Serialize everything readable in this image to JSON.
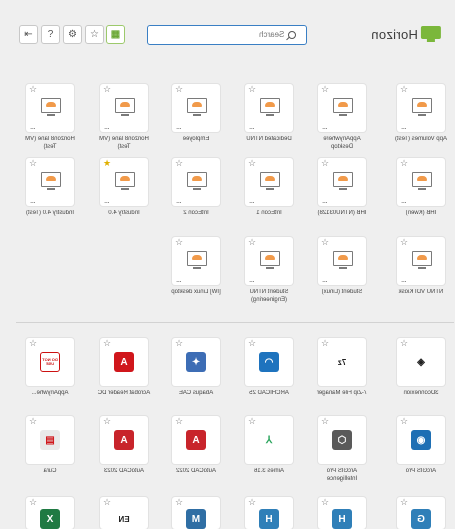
{
  "header": {
    "logo_text": "Horizon",
    "search_placeholder": "Search"
  },
  "toolbar": {
    "buttons": [
      "apps-grid",
      "favorites",
      "settings",
      "help",
      "logout"
    ]
  },
  "desktops": [
    {
      "label": "App Volumes (Test)",
      "fav": false
    },
    {
      "label": "AppAnywhere Desktop",
      "fav": false
    },
    {
      "label": "Dedicated NTNU",
      "fav": false
    },
    {
      "label": "Employee",
      "fav": false
    },
    {
      "label": "Horizon8 lane (VM Test)",
      "fav": false
    },
    {
      "label": "Horizon8 lane (VM Test)",
      "fav": false
    },
    {
      "label": "IHB (Kwen)",
      "fav": false
    },
    {
      "label": "IHB (NTNU03128)",
      "fav": false
    },
    {
      "label": "IntEcon 1",
      "fav": false
    },
    {
      "label": "IntEcon 2",
      "fav": false
    },
    {
      "label": "Industry 4.0",
      "fav": true
    },
    {
      "label": "Industry 4.0 (Test)",
      "fav": false
    },
    {
      "label": "NTNU VDI Kiosk",
      "fav": false
    },
    {
      "label": "Student (Linux)",
      "fav": false
    },
    {
      "label": "Student NTNU (Engineering)",
      "fav": false
    },
    {
      "label": "[IW] Linux desktop",
      "fav": false
    }
  ],
  "apps": [
    {
      "label": "3Dconnexion",
      "icon": "3dconnexion-icon",
      "glyph": "◈",
      "color": "#ffffff",
      "fg": "#222222"
    },
    {
      "label": "7-Zip File Manager",
      "icon": "7zip-icon",
      "glyph": "7z",
      "color": "#ffffff",
      "fg": "#222222"
    },
    {
      "label": "ARCHICAD 25",
      "icon": "archicad-icon",
      "glyph": "◠",
      "color": "#1e73be",
      "fg": "#ffffff"
    },
    {
      "label": "Abaqus CAE",
      "icon": "abaqus-icon",
      "glyph": "✦",
      "color": "#3d6db5",
      "fg": "#ffffff"
    },
    {
      "label": "Acrobat Reader DC",
      "icon": "acrobat-icon",
      "glyph": "A",
      "color": "#d0161b",
      "fg": "#ffffff"
    },
    {
      "label": "AppAnywhe...",
      "icon": "appanywhere-icon",
      "glyph": "DO NOT USE",
      "color": "#ffffff",
      "fg": "#cc1111"
    },
    {
      "label": "ArcGIS Pro",
      "icon": "arcgis-icon",
      "glyph": "◉",
      "color": "#1e6fb4",
      "fg": "#ffffff"
    },
    {
      "label": "ArcGIS Pro Intelligence",
      "icon": "arcgis-intel-icon",
      "glyph": "⬡",
      "color": "#5a5a5a",
      "fg": "#ffffff"
    },
    {
      "label": "Aimes 3.16",
      "icon": "aimes-icon",
      "glyph": "⅄",
      "color": "#ffffff",
      "fg": "#27a35a"
    },
    {
      "label": "AutoCAD 2022",
      "icon": "autocad-icon",
      "glyph": "A",
      "color": "#c8242b",
      "fg": "#ffffff"
    },
    {
      "label": "AutoCAD 2023",
      "icon": "autocad-2023-icon",
      "glyph": "A",
      "color": "#c8242b",
      "fg": "#ffffff"
    },
    {
      "label": "Cura",
      "icon": "cura-icon",
      "glyph": "▤",
      "color": "#e9e9e9",
      "fg": "#d0161b"
    }
  ],
  "apps_row3": [
    {
      "icon": "excel-icon",
      "glyph": "X",
      "color": "#1f7a43",
      "fg": "#ffffff"
    },
    {
      "icon": "en-icon",
      "glyph": "EN",
      "color": "#ffffff",
      "fg": "#222222"
    },
    {
      "icon": "matlab-m-icon",
      "glyph": "M",
      "color": "#2f6ea4",
      "fg": "#ffffff"
    },
    {
      "icon": "hyper-h-icon",
      "glyph": "H",
      "color": "#2f7fb8",
      "fg": "#ffffff"
    },
    {
      "icon": "hyper-h2-icon",
      "glyph": "H",
      "color": "#2f7fb8",
      "fg": "#ffffff"
    },
    {
      "icon": "g-app-icon",
      "glyph": "G",
      "color": "#2f7fb8",
      "fg": "#ffffff"
    }
  ]
}
